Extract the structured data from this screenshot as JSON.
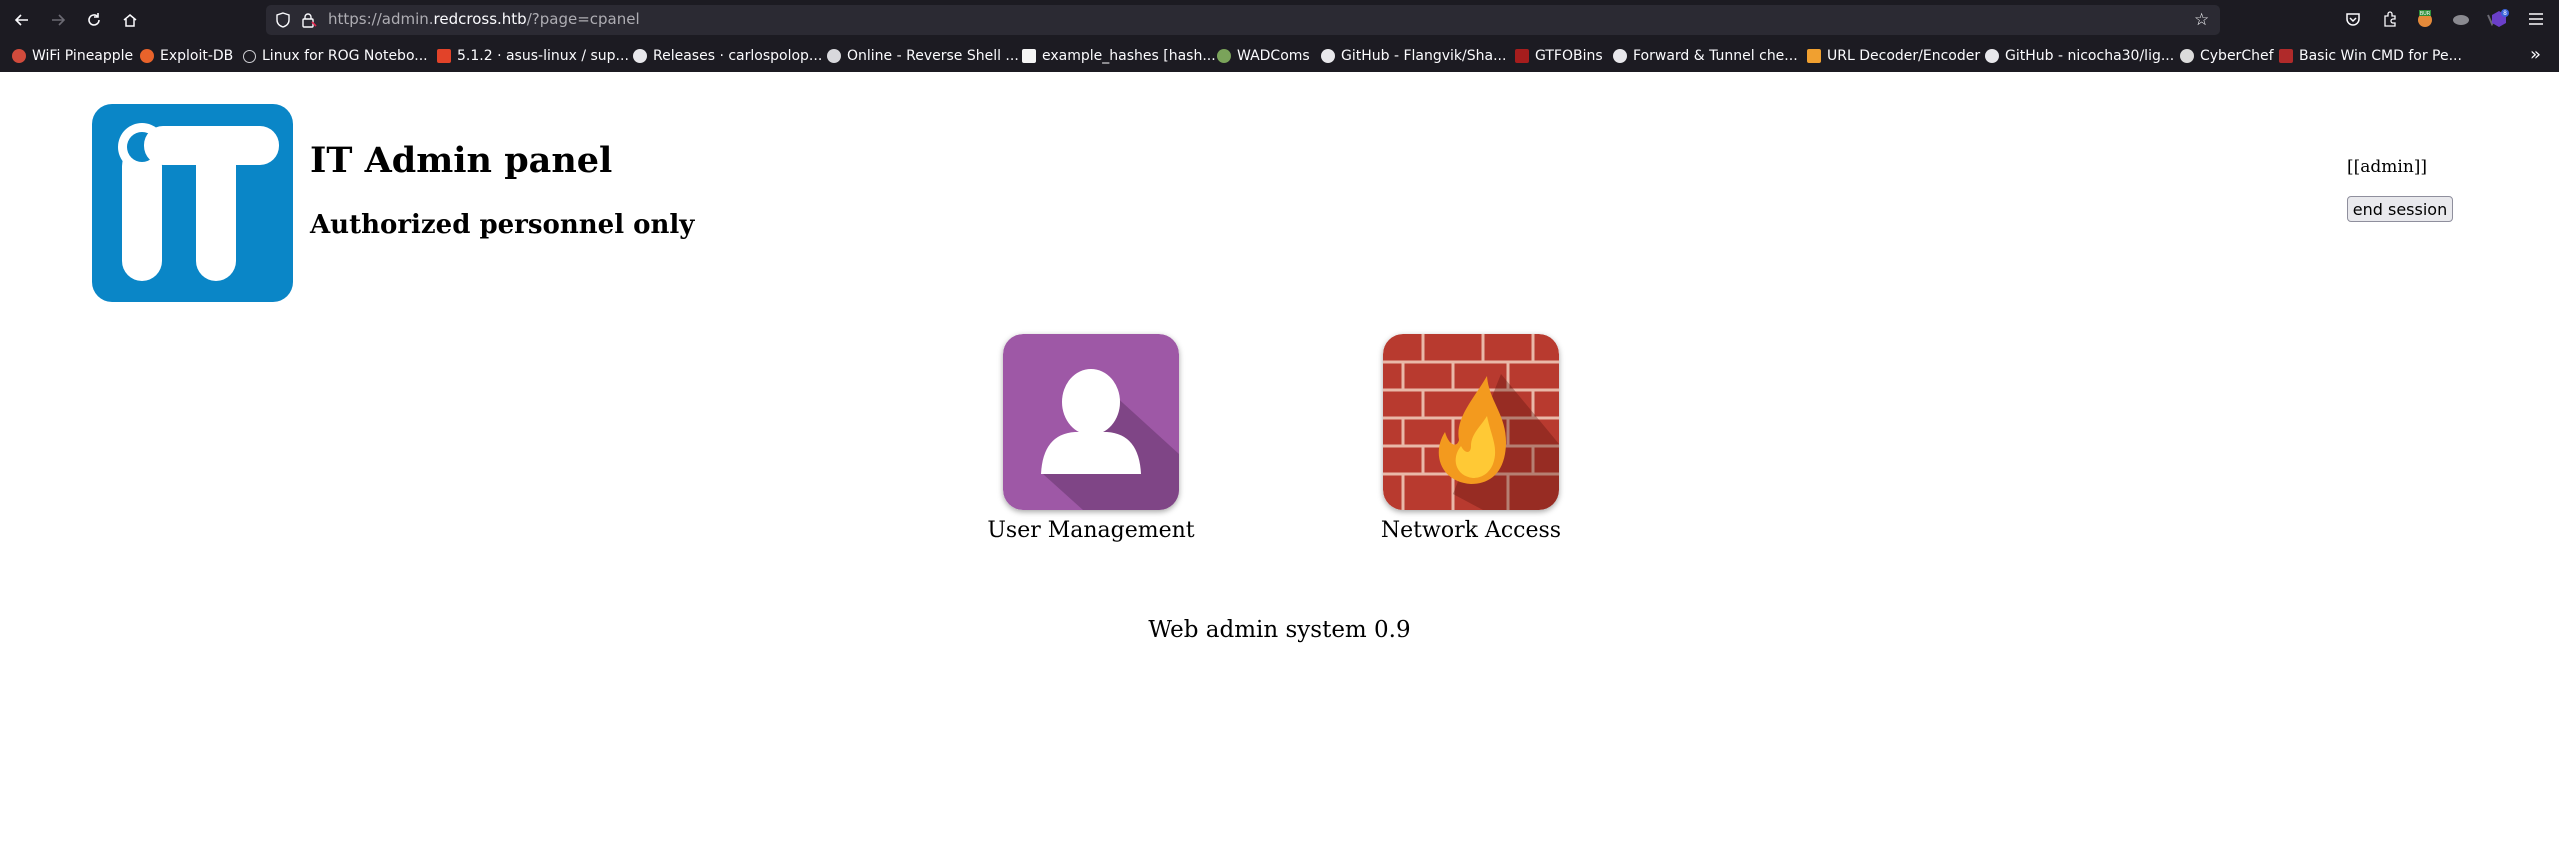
{
  "browser": {
    "url_prefix": "https://admin.",
    "url_domain": "redcross.htb",
    "url_path": "/?page=cpanel",
    "bookmarks": [
      {
        "label": "WiFi Pineapple",
        "color": "#d14b3c"
      },
      {
        "label": "Exploit-DB",
        "color": "#e8632b"
      },
      {
        "label": "Linux for ROG Notebo...",
        "color": "#cfcfd4"
      },
      {
        "label": "5.1.2 · asus-linux / sup...",
        "color": "#e24329"
      },
      {
        "label": "Releases · carlospolop...",
        "color": "#e8e8ec"
      },
      {
        "label": "Online - Reverse Shell ...",
        "color": "#d8d8dc"
      },
      {
        "label": "example_hashes [hash...",
        "color": "#f5f5f5"
      },
      {
        "label": "WADComs",
        "color": "#7aa35a"
      },
      {
        "label": "GitHub - Flangvik/Sha...",
        "color": "#e8e8ec"
      },
      {
        "label": "GTFOBins",
        "color": "#a61d1d"
      },
      {
        "label": "Forward & Tunnel che...",
        "color": "#e8e8ec"
      },
      {
        "label": "URL Decoder/Encoder",
        "color": "#f0a030"
      },
      {
        "label": "GitHub - nicocha30/lig...",
        "color": "#e8e8ec"
      },
      {
        "label": "CyberChef",
        "color": "#dcdcdc"
      },
      {
        "label": "Basic Win CMD for Pe...",
        "color": "#b02a2a"
      }
    ]
  },
  "header": {
    "title": "IT Admin panel",
    "subtitle": "Authorized personnel only",
    "user": "[[admin]]",
    "end_session_label": "end session"
  },
  "apps": [
    {
      "label": "User Management",
      "icon": "user-icon",
      "color": "#9e58a6"
    },
    {
      "label": "Network Access",
      "icon": "firewall-icon",
      "color": "#b83a2f"
    }
  ],
  "footer": {
    "text": "Web admin system 0.9"
  },
  "colors": {
    "logo_blue": "#0a86c7",
    "chrome_bg": "#1c1b22",
    "urlbar_bg": "#2b2a33"
  }
}
